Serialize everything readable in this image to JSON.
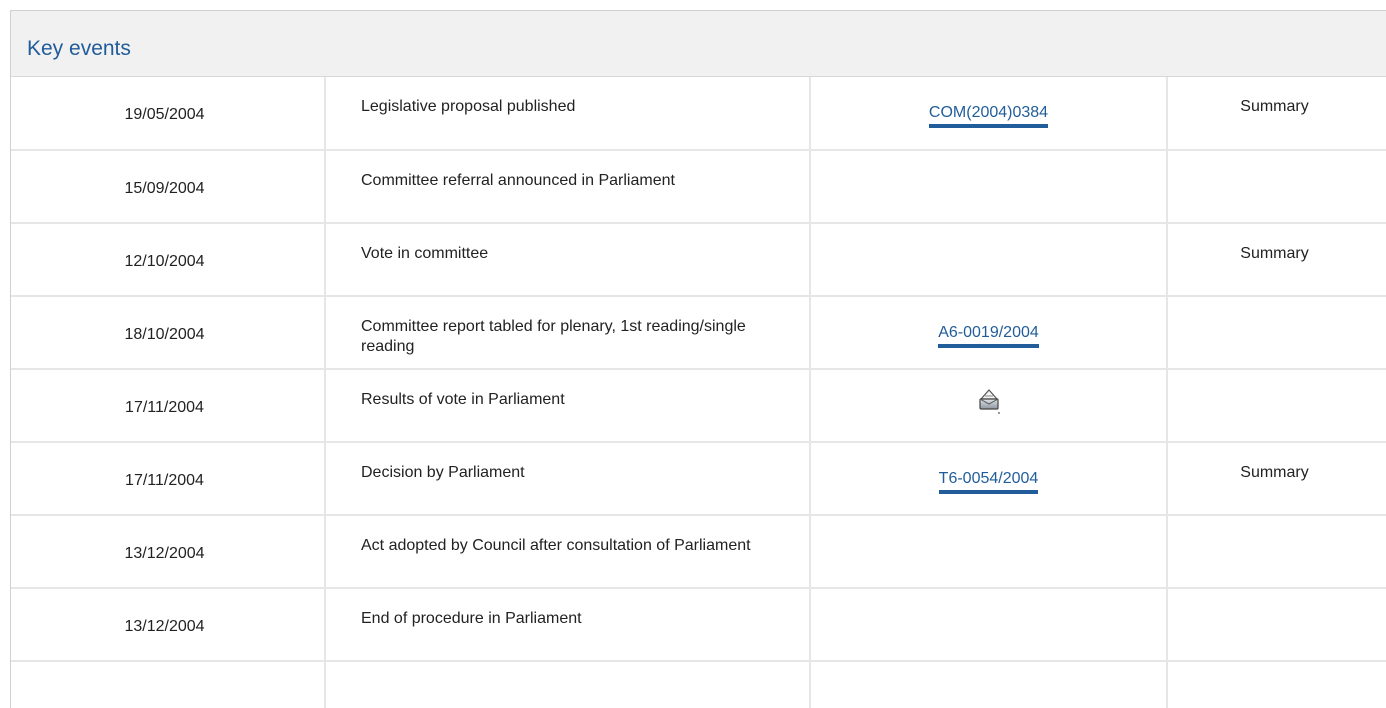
{
  "section": {
    "title": "Key events"
  },
  "events": [
    {
      "date": "19/05/2004",
      "event": "Legislative proposal published",
      "document": "COM(2004)0384",
      "summary": "Summary"
    },
    {
      "date": "15/09/2004",
      "event": "Committee referral announced in Parliament",
      "document": "",
      "summary": ""
    },
    {
      "date": "12/10/2004",
      "event": "Vote in committee",
      "document": "",
      "summary": "Summary"
    },
    {
      "date": "18/10/2004",
      "event": "Committee report tabled for plenary, 1st reading/single reading",
      "document": "A6-0019/2004",
      "summary": ""
    },
    {
      "date": "17/11/2004",
      "event": "Results of vote in Parliament",
      "document_icon": "ballot-box-icon",
      "summary": ""
    },
    {
      "date": "17/11/2004",
      "event": "Decision by Parliament",
      "document": "T6-0054/2004",
      "summary": "Summary"
    },
    {
      "date": "13/12/2004",
      "event": "Act adopted by Council after consultation of Parliament",
      "document": "",
      "summary": ""
    },
    {
      "date": "13/12/2004",
      "event": "End of procedure in Parliament",
      "document": "",
      "summary": ""
    }
  ],
  "colors": {
    "link": "#215d9a",
    "header_bg": "#f1f1f1",
    "grid": "#e6e6e6"
  }
}
